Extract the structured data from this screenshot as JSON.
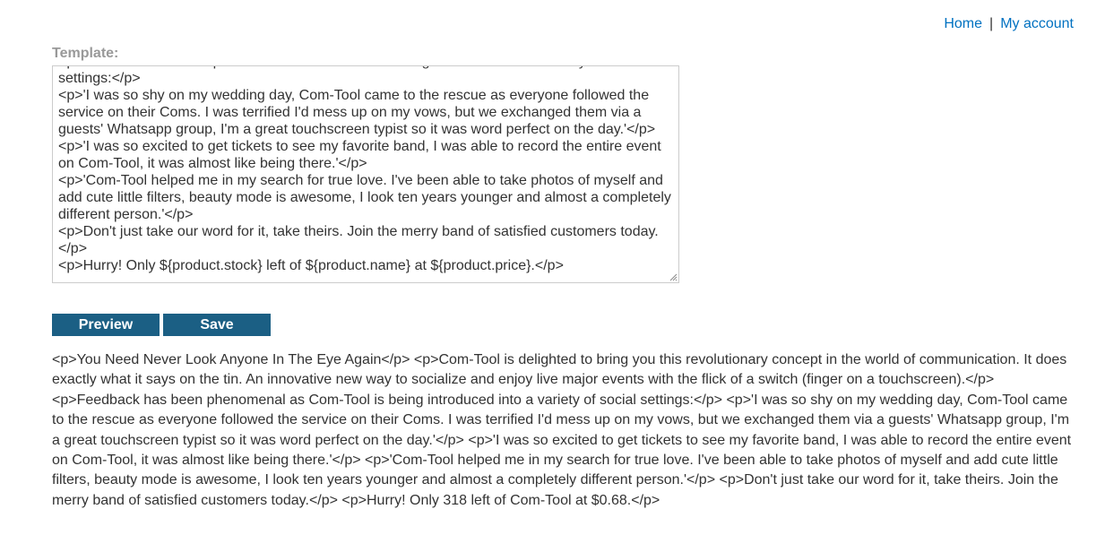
{
  "nav": {
    "home_label": "Home",
    "separator": "|",
    "account_label": "My account"
  },
  "template": {
    "label": "Template:",
    "value": "<p>Feedback has been phenomenal as Com-Tool is being introduced into a variety of social settings:</p>\n<p>'I was so shy on my wedding day, Com-Tool came to the rescue as everyone followed the service on their Coms. I was terrified I'd mess up on my vows, but we exchanged them via a guests' Whatsapp group, I'm a great touchscreen typist so it was word perfect on the day.'</p>\n<p>'I was so excited to get tickets to see my favorite band, I was able to record the entire event on Com-Tool, it was almost like being there.'</p>\n<p>'Com-Tool helped me in my search for true love. I've been able to take photos of myself and add cute little filters, beauty mode is awesome, I look ten years younger and almost a completely different person.'</p>\n<p>Don't just take our word for it, take theirs. Join the merry band of satisfied customers today.</p>\n<p>Hurry! Only ${product.stock} left of ${product.name} at ${product.price}.</p>"
  },
  "buttons": {
    "preview_label": "Preview",
    "save_label": "Save"
  },
  "preview": {
    "text": "<p>You Need Never Look Anyone In The Eye Again</p> <p>Com-Tool is delighted to bring you this revolutionary concept in the world of communication. It does exactly what it says on the tin. An innovative new way to socialize and enjoy live major events with the flick of a switch (finger on a touchscreen).</p> <p>Feedback has been phenomenal as Com-Tool is being introduced into a variety of social settings:</p> <p>'I was so shy on my wedding day, Com-Tool came to the rescue as everyone followed the service on their Coms. I was terrified I'd mess up on my vows, but we exchanged them via a guests' Whatsapp group, I'm a great touchscreen typist so it was word perfect on the day.'</p> <p>'I was so excited to get tickets to see my favorite band, I was able to record the entire event on Com-Tool, it was almost like being there.'</p> <p>'Com-Tool helped me in my search for true love. I've been able to take photos of myself and add cute little filters, beauty mode is awesome, I look ten years younger and almost a completely different person.'</p> <p>Don't just take our word for it, take theirs. Join the merry band of satisfied customers today.</p> <p>Hurry! Only 318 left of Com-Tool at $0.68.</p>"
  },
  "colors": {
    "link": "#0071c1",
    "button_bg": "#1b5f84",
    "label_gray": "#999999"
  }
}
